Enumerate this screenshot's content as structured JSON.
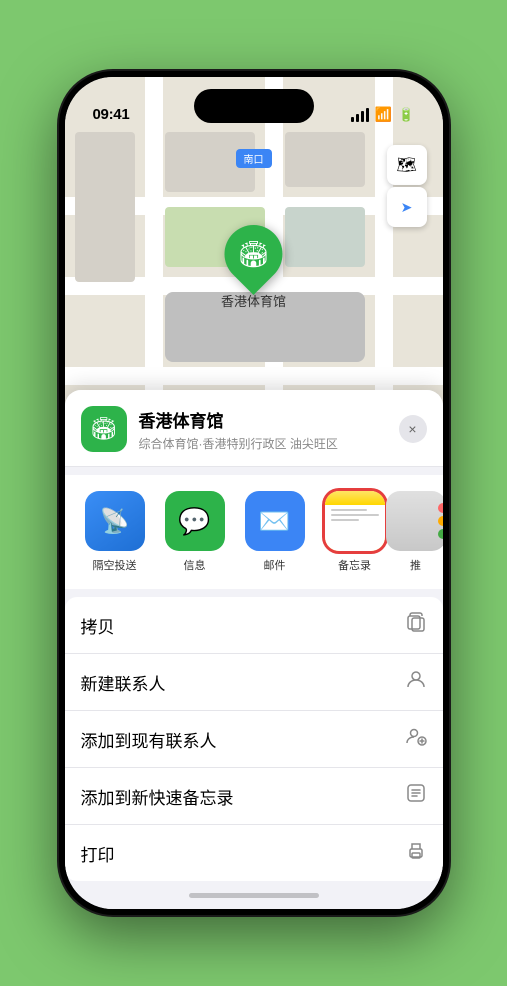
{
  "statusBar": {
    "time": "09:41",
    "locationArrow": "▲"
  },
  "mapControls": {
    "mapTypeLabel": "🗺",
    "locationLabel": "➤"
  },
  "locationBadge": {
    "text": "南口"
  },
  "mapPin": {
    "emoji": "🏟",
    "label": "香港体育馆"
  },
  "venueSheet": {
    "venueName": "香港体育馆",
    "venueSubtitle": "综合体育馆·香港特别行政区 油尖旺区",
    "closeLabel": "×"
  },
  "shareItems": [
    {
      "id": "airdrop",
      "label": "隔空投送",
      "emoji": "📡"
    },
    {
      "id": "messages",
      "label": "信息",
      "emoji": "💬"
    },
    {
      "id": "mail",
      "label": "邮件",
      "emoji": "✉"
    },
    {
      "id": "notes",
      "label": "备忘录",
      "emoji": ""
    },
    {
      "id": "more",
      "label": "推",
      "emoji": "···"
    }
  ],
  "actionItems": [
    {
      "label": "拷贝",
      "iconType": "copy"
    },
    {
      "label": "新建联系人",
      "iconType": "person"
    },
    {
      "label": "添加到现有联系人",
      "iconType": "person-add"
    },
    {
      "label": "添加到新快速备忘录",
      "iconType": "note"
    },
    {
      "label": "打印",
      "iconType": "printer"
    }
  ],
  "colors": {
    "accent": "#2db34a",
    "notesYellow": "#ffcd00",
    "notesRed": "#e53e3e"
  }
}
